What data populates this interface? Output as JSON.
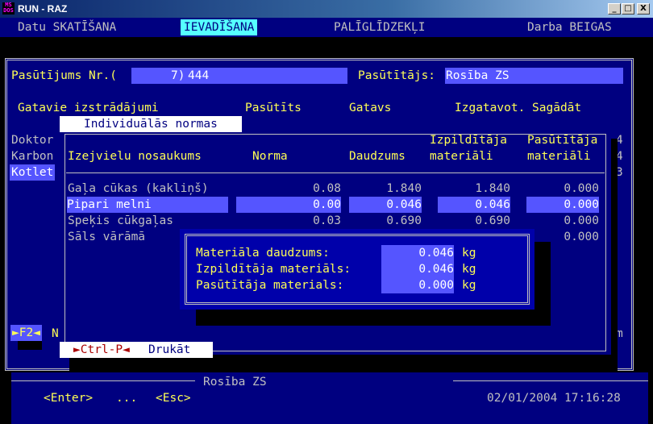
{
  "window": {
    "title": "RUN - RAZ",
    "icon_text": "MS DOS",
    "minimize": "_",
    "maximize": "□",
    "close": "X"
  },
  "menu": {
    "items": [
      {
        "label": "Datu SKATĪŠANA"
      },
      {
        "label": "IEVADĪŠANA"
      },
      {
        "label": "PALĪGLĪDZEKĻI"
      },
      {
        "label": "Darba BEIGAS"
      }
    ]
  },
  "order": {
    "number_label": "Pasūtījums Nr.(",
    "number_prefix": "7)",
    "number_value": "444",
    "customer_label": "Pasūtītājs:",
    "customer_value": "Rosība ZS"
  },
  "products_header": {
    "col1": "Gatavie izstrādājumi",
    "col2": "Pasūtīts",
    "col3": "Gatavs",
    "col4": "Izgatavot. Sagādāt"
  },
  "products_left": [
    "Doktor",
    "Karbon",
    "Kotlet"
  ],
  "products_right": [
    "4",
    "4",
    "3"
  ],
  "norms_window": {
    "title": "Individuālās normas",
    "header_row1": {
      "executor": "Izpildītāja",
      "customer": "Pasūtītāja"
    },
    "header_row2": {
      "name": "Izejvielu nosaukums",
      "norm": "Norma",
      "quantity": "Daudzums",
      "executor": "materiāli",
      "customer": "materiāli"
    },
    "rows": [
      {
        "name": "Gaļa cūkas (kakliņš)",
        "norm": "0.08",
        "qty": "1.840",
        "exec": "1.840",
        "cust": "0.000"
      },
      {
        "name": "Pipari melni",
        "norm": "0.00",
        "qty": "0.046",
        "exec": "0.046",
        "cust": "0.000"
      },
      {
        "name": "Speķis cūkgaļas",
        "norm": "0.03",
        "qty": "0.690",
        "exec": "0.690",
        "cust": "0.000"
      },
      {
        "name": "Sāls vārāmā",
        "norm": "",
        "qty": "",
        "exec": "",
        "cust": "0.000"
      }
    ],
    "print_hint_key": "►Ctrl-P◄",
    "print_hint_label": "Drukāt"
  },
  "popup": {
    "rows": [
      {
        "label": "Materiāla daudzums:",
        "value": "0.046",
        "unit": "kg"
      },
      {
        "label": "Izpildītāja materiāls:",
        "value": "0.046",
        "unit": "kg"
      },
      {
        "label": "Pasūtītāja materials:",
        "value": "0.000",
        "unit": "kg"
      }
    ]
  },
  "f2_hint": {
    "key": "►F2◄",
    "label": "N"
  },
  "right_edge_char": "m",
  "footer": {
    "customer": "Rosība ZS",
    "enter": "<Enter>",
    "dots": "...",
    "esc": "<Esc>",
    "datetime": "02/01/2004 17:16:28"
  }
}
